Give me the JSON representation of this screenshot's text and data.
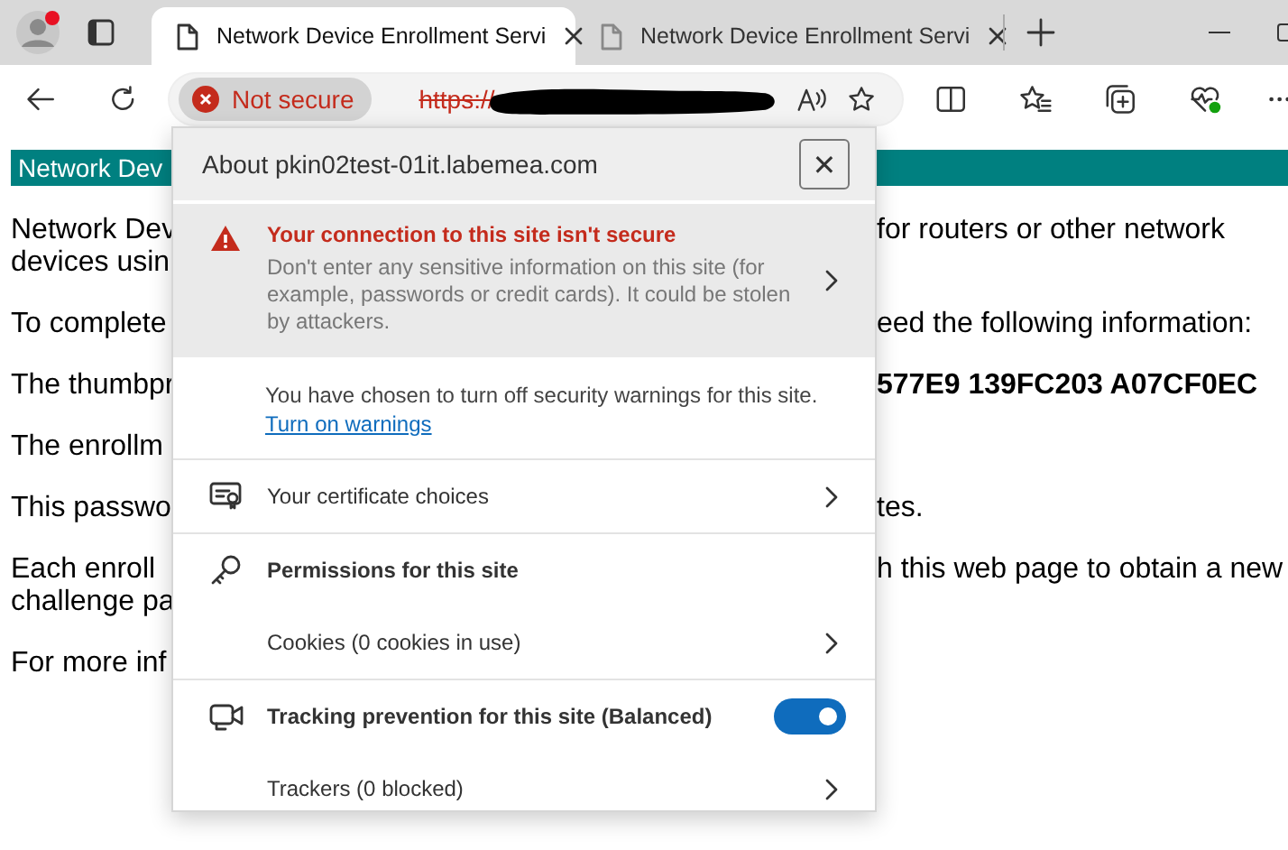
{
  "tabs": [
    {
      "title": "Network Device Enrollment Servi",
      "selected": true
    },
    {
      "title": "Network Device Enrollment Servi",
      "selected": false
    }
  ],
  "address_bar": {
    "security_chip": "Not secure",
    "url_scheme": "https://"
  },
  "page": {
    "header": "Network Dev",
    "paragraphs": [
      {
        "lines": [
          {
            "left": "Network Dev",
            "right": "for routers or other network"
          },
          {
            "left": "devices usin"
          }
        ]
      },
      {
        "lines": [
          {
            "left": "To complete",
            "right": "eed the following information:"
          }
        ]
      },
      {
        "lines": [
          {
            "left": "The thumbpr",
            "right": "577E9 139FC203 A07CF0EC",
            "bold": true
          }
        ]
      },
      {
        "lines": [
          {
            "left": "The enrollm"
          }
        ]
      },
      {
        "lines": [
          {
            "left": "This passwo",
            "right": "tes."
          }
        ]
      },
      {
        "lines": [
          {
            "left": "Each enroll",
            "right": "h this web page to obtain a new"
          },
          {
            "left": "challenge pa"
          }
        ]
      },
      {
        "lines": [
          {
            "left": "For more inf"
          }
        ]
      }
    ]
  },
  "site_info": {
    "title": "About pkin02test-01it.labemea.com",
    "close": "✕",
    "warning": {
      "heading": "Your connection to this site isn't secure",
      "body": "Don't enter any sensitive information on this site (for example, passwords or credit cards). It could be stolen by attackers."
    },
    "notice": {
      "text": "You have chosen to turn off security warnings for this site.",
      "link": "Turn on warnings"
    },
    "sections": [
      [
        {
          "kind": "nav",
          "label": "Your certificate choices"
        }
      ],
      [
        {
          "kind": "heading",
          "label": "Permissions for this site"
        },
        {
          "kind": "nav",
          "label": "Cookies (0 cookies in use)"
        }
      ],
      [
        {
          "kind": "toggle",
          "label": "Tracking prevention for this site (Balanced)",
          "on": true
        },
        {
          "kind": "nav",
          "label": "Trackers (0 blocked)"
        }
      ]
    ]
  }
}
